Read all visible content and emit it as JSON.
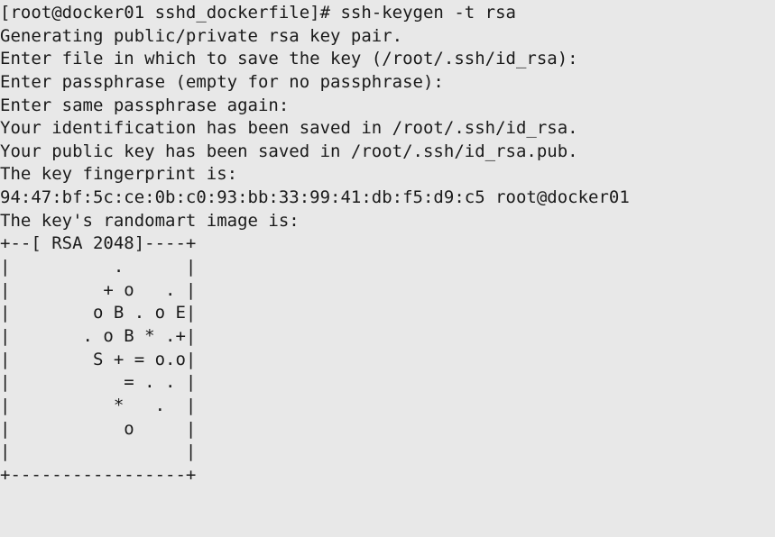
{
  "terminal": {
    "prompt": "[root@docker01 sshd_dockerfile]# ssh-keygen -t rsa",
    "lines": [
      "Generating public/private rsa key pair.",
      "Enter file in which to save the key (/root/.ssh/id_rsa):",
      "Enter passphrase (empty for no passphrase):",
      "Enter same passphrase again:",
      "Your identification has been saved in /root/.ssh/id_rsa.",
      "Your public key has been saved in /root/.ssh/id_rsa.pub.",
      "The key fingerprint is:",
      "94:47:bf:5c:ce:0b:c0:93:bb:33:99:41:db:f5:d9:c5 root@docker01",
      "The key's randomart image is:",
      "+--[ RSA 2048]----+",
      "|          .      |",
      "|         + o   . |",
      "|        o B . o E|",
      "|       . o B * .+|",
      "|        S + = o.o|",
      "|           = . . |",
      "|          *   .  |",
      "|           o     |",
      "|                 |",
      "+-----------------+"
    ]
  }
}
